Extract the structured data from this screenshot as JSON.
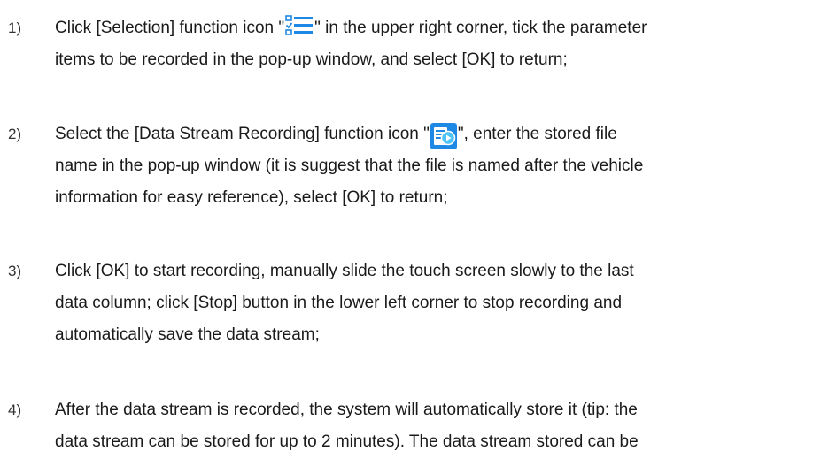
{
  "steps": [
    {
      "number": "1)",
      "line1_before_icon": "Click [Selection] function icon \"",
      "icon": "selection-list-icon",
      "line1_after_icon": "\" in the upper right corner, tick the parameter",
      "line2": "items to be recorded in the pop-up window, and select [OK] to return;"
    },
    {
      "number": "2)",
      "line1_before_icon": "Select the [Data Stream Recording] function icon \"",
      "icon": "data-stream-recording-icon",
      "line1_after_icon": "\", enter the stored file",
      "line2": "name in the pop-up window (it is suggest that the file is named after the vehicle",
      "line3": "information for easy reference), select [OK] to return;"
    },
    {
      "number": "3)",
      "line1": "Click [OK] to start recording, manually slide the touch screen slowly to the last",
      "line2": "data column; click [Stop] button in the lower left corner to stop recording and",
      "line3": "automatically save the data stream;"
    },
    {
      "number": "4)",
      "line1": "After the data stream is recorded, the system will automatically store it (tip: the",
      "line2": "data stream can be stored for up to 2 minutes). The data stream stored can be"
    }
  ],
  "colors": {
    "icon_blue": "#1e88e5",
    "icon_light": "#4fc3f7"
  }
}
